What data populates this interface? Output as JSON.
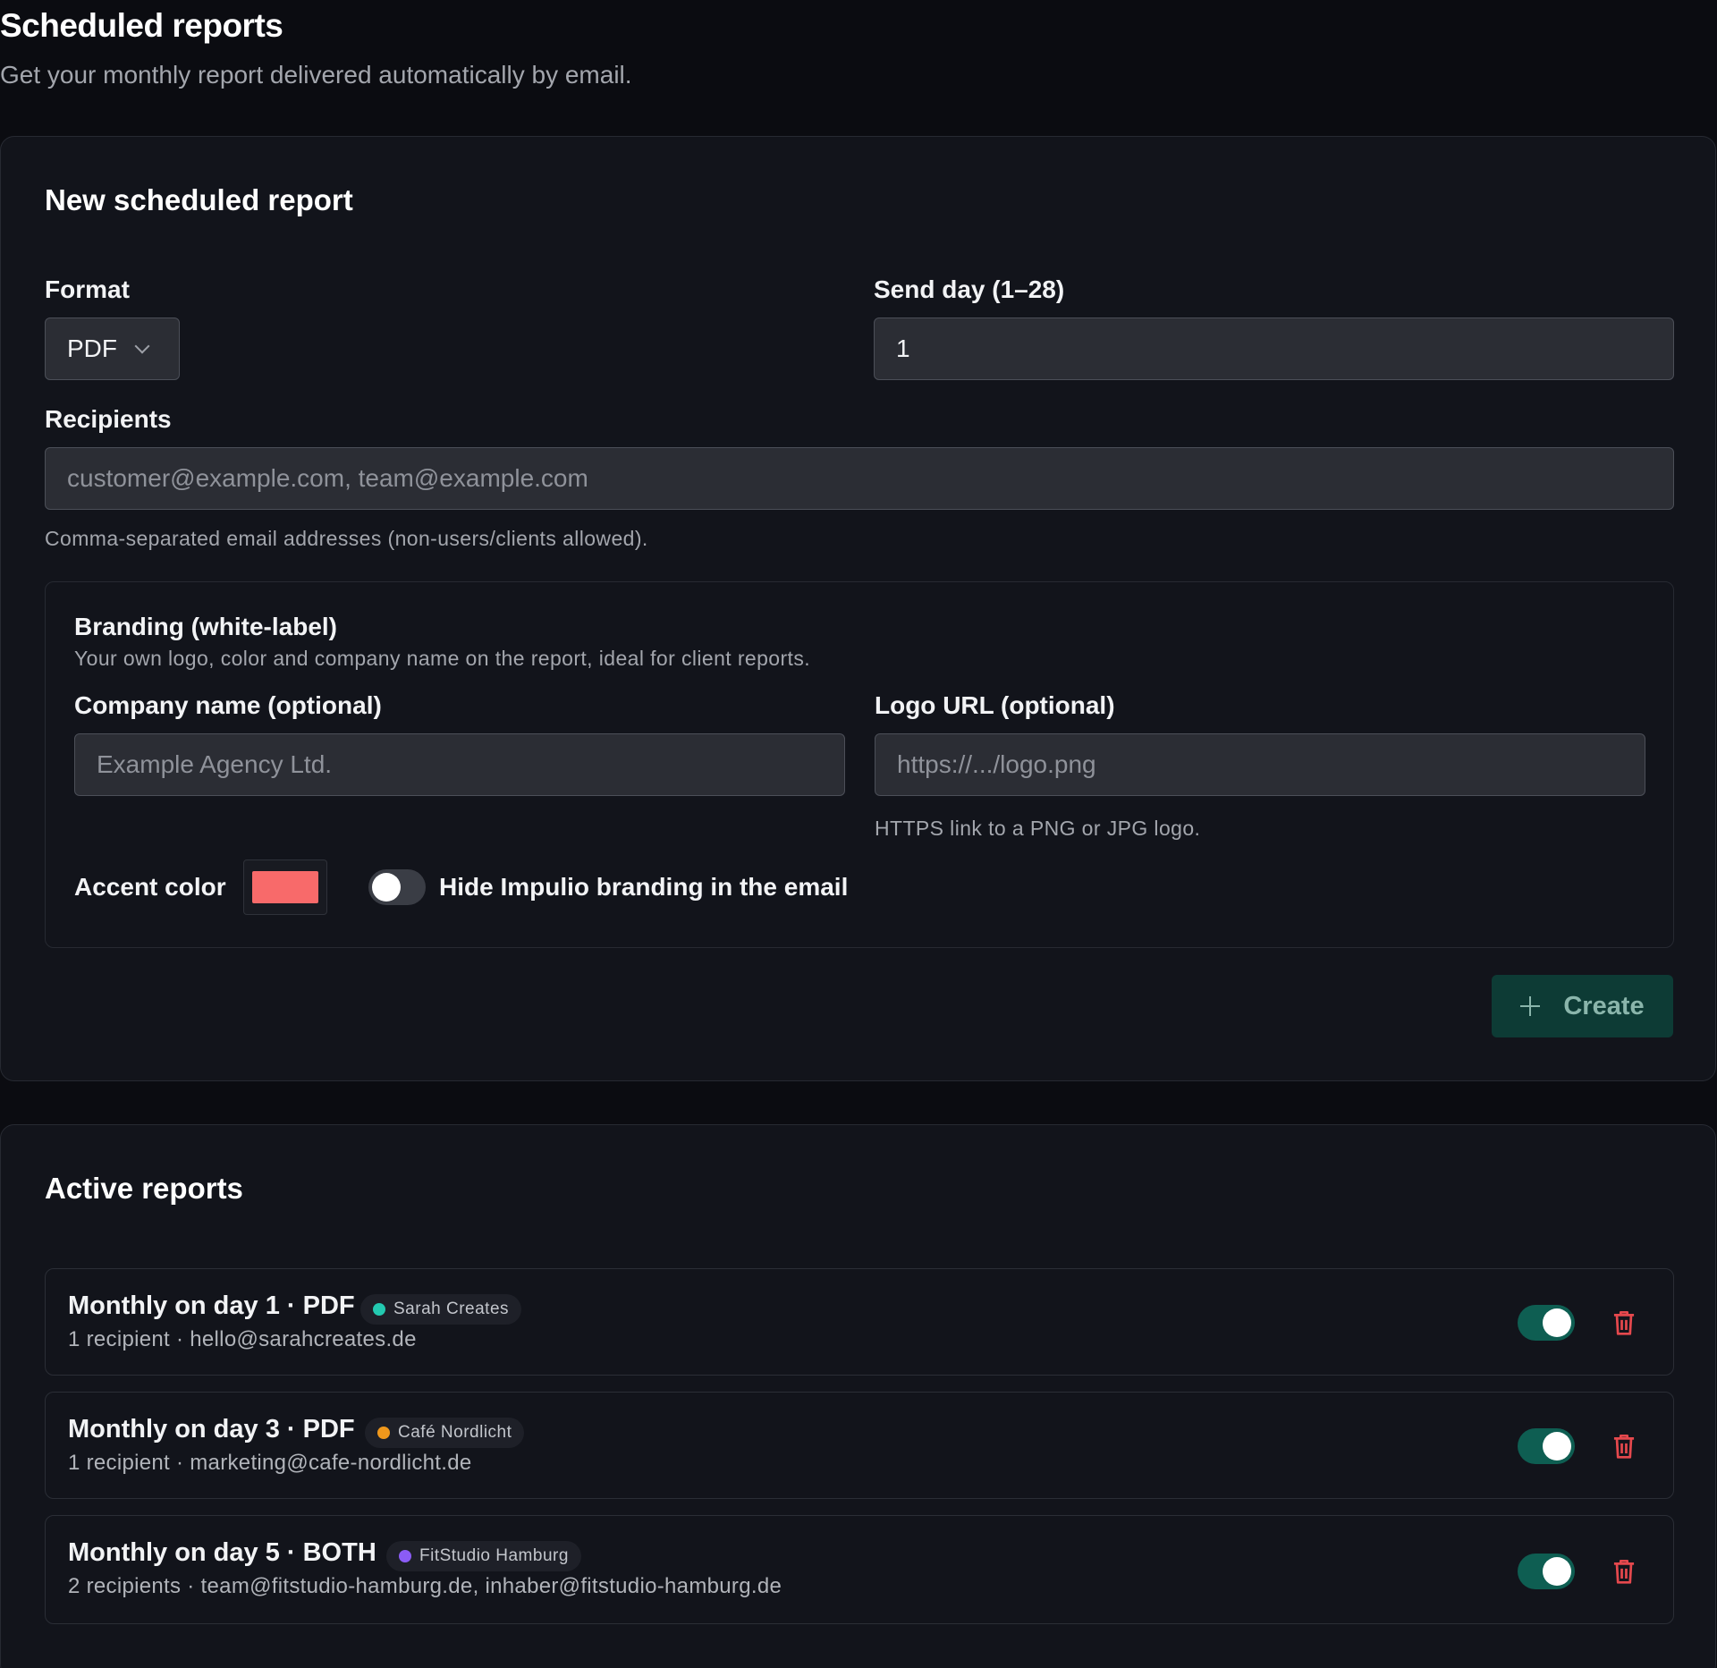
{
  "header": {
    "title": "Scheduled reports",
    "subtitle": "Get your monthly report delivered automatically by email."
  },
  "new_report": {
    "title": "New scheduled report",
    "format": {
      "label": "Format",
      "value": "PDF"
    },
    "send_day": {
      "label": "Send day (1–28)",
      "value": "1"
    },
    "recipients": {
      "label": "Recipients",
      "placeholder": "customer@example.com, team@example.com",
      "hint": "Comma-separated email addresses (non-users/clients allowed)."
    },
    "branding": {
      "title": "Branding (white-label)",
      "description": "Your own logo, color and company name on the report, ideal for client reports.",
      "company": {
        "label": "Company name (optional)",
        "placeholder": "Example Agency Ltd."
      },
      "logo": {
        "label": "Logo URL (optional)",
        "placeholder": "https://.../logo.png",
        "hint": "HTTPS link to a PNG or JPG logo."
      },
      "accent": {
        "label": "Accent color",
        "color": "#f86a6a"
      },
      "hide_branding": {
        "label": "Hide Impulio branding in the email",
        "on": false
      }
    },
    "create_label": "Create"
  },
  "active": {
    "title": "Active reports",
    "reports": [
      {
        "title": "Monthly on day 1 · PDF",
        "client": "Sarah Creates",
        "dot": "#23c9b0",
        "sub": "1 recipient · hello@sarahcreates.de",
        "enabled": true
      },
      {
        "title": "Monthly on day 3 · PDF",
        "client": "Café Nordlicht",
        "dot": "#f0981c",
        "sub": "1 recipient · marketing@cafe-nordlicht.de",
        "enabled": true
      },
      {
        "title": "Monthly on day 5 · BOTH",
        "client": "FitStudio Hamburg",
        "dot": "#8b5cf6",
        "sub": "2 recipients · team@fitstudio-hamburg.de, inhaber@fitstudio-hamburg.de",
        "enabled": true
      }
    ]
  },
  "colors": {
    "toggle_on": "#0e5e52",
    "delete": "#e5484d",
    "primary_button": "#0d3b35"
  }
}
